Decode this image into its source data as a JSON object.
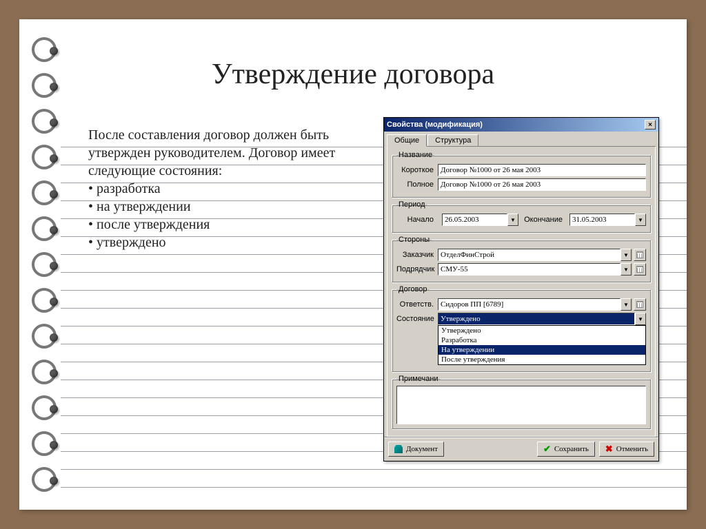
{
  "slide": {
    "title": "Утверждение договора",
    "paragraph": "После составления договор должен быть утвержден руководителем. Договор имеет следующие состояния:",
    "bullets": [
      "разработка",
      "на утверждении",
      "после утверждения",
      "утверждено"
    ]
  },
  "dialog": {
    "title": "Свойства (модификация)",
    "tabs": {
      "general": "Общие",
      "structure": "Структура"
    },
    "groups": {
      "name": {
        "legend": "Название",
        "short_label": "Короткое",
        "short_value": "Договор №1000 от 26 мая 2003",
        "full_label": "Полное",
        "full_value": "Договор №1000 от 26 мая 2003"
      },
      "period": {
        "legend": "Период",
        "start_label": "Начало",
        "start_value": "26.05.2003",
        "end_label": "Окончание",
        "end_value": "31.05.2003"
      },
      "parties": {
        "legend": "Стороны",
        "customer_label": "Заказчик",
        "customer_value": "ОтделФинСтрой",
        "contractor_label": "Подрядчик",
        "contractor_value": "СМУ-55"
      },
      "contract": {
        "legend": "Договор",
        "responsible_label": "Ответств.",
        "responsible_value": "Сидоров ПП [6789]",
        "status_label": "Состояние",
        "status_value": "Утверждено"
      },
      "notes": {
        "legend": "Примечани"
      }
    },
    "status_options": [
      "Утверждено",
      "Разработка",
      "На утверждении",
      "После утверждения"
    ],
    "status_selected_index": 2,
    "buttons": {
      "document": "Документ",
      "save": "Сохранить",
      "cancel": "Отменить"
    }
  }
}
